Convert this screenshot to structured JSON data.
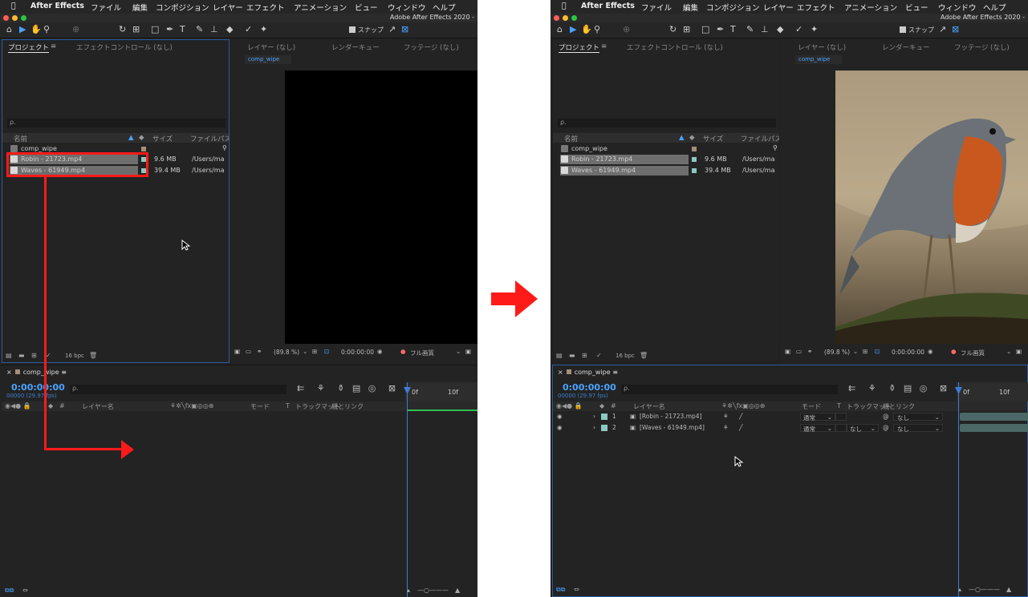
{
  "menubar": {
    "apple": "",
    "app_name": "After Effects",
    "items": [
      "ファイル",
      "編集",
      "コンポジション",
      "レイヤー",
      "エフェクト",
      "アニメーション",
      "ビュー",
      "ウィンドウ",
      "ヘルプ"
    ]
  },
  "window_title": "Adobe After Effects 2020 -",
  "toolbar": {
    "snap_label": "スナップ"
  },
  "project_panel": {
    "tab_project": "プロジェクト",
    "tab_effect_controls": "エフェクトコントロール (なし)",
    "search_placeholder": "ρ.",
    "columns": {
      "name": "名前",
      "size": "サイズ",
      "file_path": "ファイルパス"
    },
    "items": [
      {
        "name": "comp_wipe",
        "size": "",
        "path": "",
        "label_color": "#a58e7a"
      },
      {
        "name": "Robin - 21723.mp4",
        "size": "9.6 MB",
        "path": "/Users/ma",
        "label_color": "#8cc8c0"
      },
      {
        "name": "Waves - 61949.mp4",
        "size": "39.4 MB",
        "path": "/Users/ma",
        "label_color": "#8cc8c0"
      }
    ],
    "bpc": "16 bpc"
  },
  "viewer": {
    "tab_layer": "レイヤー (なし)",
    "tab_render_queue": "レンダーキュー",
    "tab_footage": "フッテージ (なし)",
    "comp_tab": "comp_wipe",
    "zoom": "(89.8 %)",
    "timecode": "0:00:00:00",
    "quality": "フル画質"
  },
  "timeline": {
    "comp_name": "comp_wipe",
    "timecode": "0:00:00:00",
    "fps": "00000 (29.97 fps)",
    "search_placeholder": "ρ.",
    "header": {
      "number": "#",
      "layer_name": "レイヤー名",
      "mode": "モード",
      "t": "T",
      "track_matte": "トラックマット",
      "parent_link": "親とリンク"
    },
    "ruler": {
      "start": "0f",
      "mark": "10f"
    },
    "layers": [
      {
        "number": "1",
        "name": "[Robin - 21723.mp4]",
        "mode": "通常",
        "matte": "",
        "parent": "なし"
      },
      {
        "number": "2",
        "name": "[Waves - 61949.mp4]",
        "mode": "通常",
        "matte": "なし",
        "parent": "なし"
      }
    ]
  },
  "colors": {
    "annotation": "#ff1a1a",
    "accent_blue": "#3d7bd6"
  }
}
